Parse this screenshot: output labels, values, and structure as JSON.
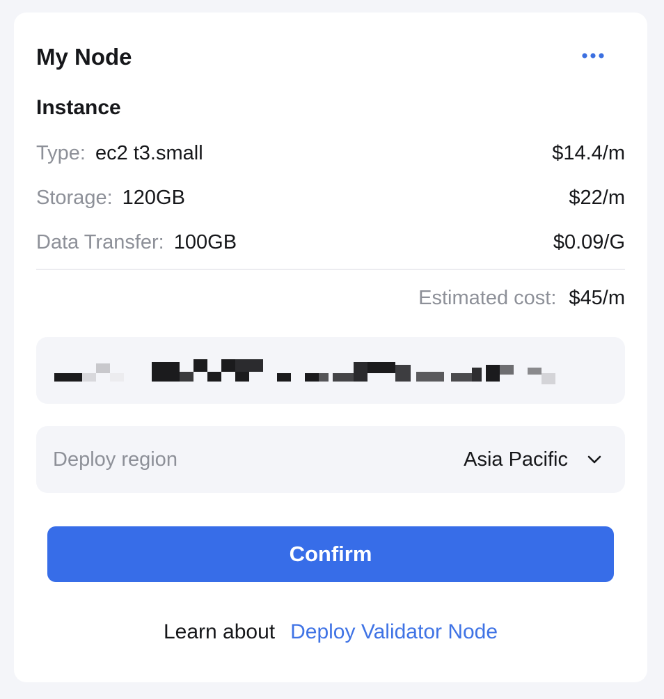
{
  "header": {
    "title": "My Node",
    "more_icon": "more-horizontal-icon"
  },
  "instance": {
    "section_title": "Instance",
    "rows": [
      {
        "label": "Type:",
        "value": "ec2 t3.small",
        "price": "$14.4/m"
      },
      {
        "label": "Storage:",
        "value": "120GB",
        "price": "$22/m"
      },
      {
        "label": "Data Transfer:",
        "value": "100GB",
        "price": "$0.09/G"
      }
    ]
  },
  "estimate": {
    "label": "Estimated cost:",
    "value": "$45/m"
  },
  "region": {
    "label": "Deploy region",
    "value": "Asia Pacific",
    "icon": "chevron-down-icon"
  },
  "confirm": {
    "label": "Confirm"
  },
  "footer": {
    "text": "Learn about",
    "link": "Deploy Validator Node"
  },
  "colors": {
    "accent": "#376de8",
    "link": "#3f73e5",
    "muted": "#8d9098",
    "background": "#f4f5f9"
  }
}
